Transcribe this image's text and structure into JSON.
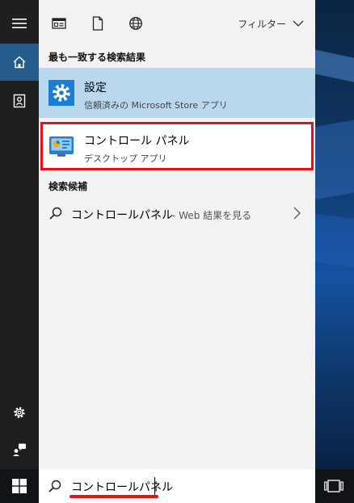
{
  "toolbar": {
    "filter_label": "フィルター"
  },
  "best_match": {
    "heading": "最も一致する検索結果",
    "settings": {
      "title": "設定",
      "subtitle": "信頼済みの Microsoft Store アプリ"
    },
    "control_panel": {
      "title": "コントロール パネル",
      "subtitle": "デスクトップ アプリ"
    }
  },
  "suggestions": {
    "heading": "検索候補",
    "items": [
      {
        "query": "コントロールパネル",
        "hint": " - Web 結果を見る"
      }
    ]
  },
  "search": {
    "value": "コントロールパネル"
  },
  "colors": {
    "accent": "#245d8c",
    "selection": "#b9d8ee",
    "highlight_box": "#e3101e",
    "settings_icon_bg": "#1a7fd4"
  }
}
